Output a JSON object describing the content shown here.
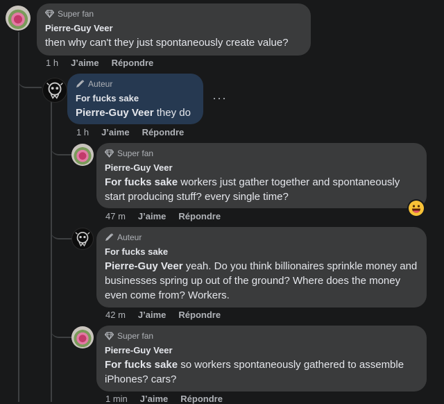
{
  "comments": [
    {
      "badge": "Super fan",
      "name": "Pierre-Guy Veer",
      "mention": "",
      "text": "then why can't they just spontaneously create value?",
      "time": "1 h",
      "like": "J’aime",
      "reply": "Répondre",
      "avatar": "flower-avatar"
    },
    {
      "badge": "Auteur",
      "name": "For fucks sake",
      "mention": "Pierre-Guy Veer",
      "text": " they do",
      "time": "1 h",
      "like": "J’aime",
      "reply": "Répondre",
      "avatar": "dark-avatar",
      "more": "···"
    },
    {
      "badge": "Super fan",
      "name": "Pierre-Guy Veer",
      "mention": "For fucks sake",
      "text": " workers just gather together and spontaneously start producing stuff? every single time?",
      "time": "47 m",
      "like": "J’aime",
      "reply": "Répondre",
      "avatar": "flower-avatar",
      "reaction": "grinning-face-emoji"
    },
    {
      "badge": "Auteur",
      "name": "For fucks sake",
      "mention": "Pierre-Guy Veer",
      "text": " yeah. Do you think billionaires sprinkle money and businesses spring up out of the ground? Where does the money even come from? Workers.",
      "time": "42 m",
      "like": "J’aime",
      "reply": "Répondre",
      "avatar": "dark-avatar"
    },
    {
      "badge": "Super fan",
      "name": "Pierre-Guy Veer",
      "mention": "For fucks sake",
      "text": " so workers spontaneously gathered to assemble iPhones? cars?",
      "time": "1 min",
      "like": "J’aime",
      "reply": "Répondre",
      "avatar": "flower-avatar"
    }
  ],
  "colors": {
    "background": "#18191a",
    "bubble": "#3a3b3c",
    "author_bubble": "#263951",
    "muted_text": "#b0b3b8"
  }
}
